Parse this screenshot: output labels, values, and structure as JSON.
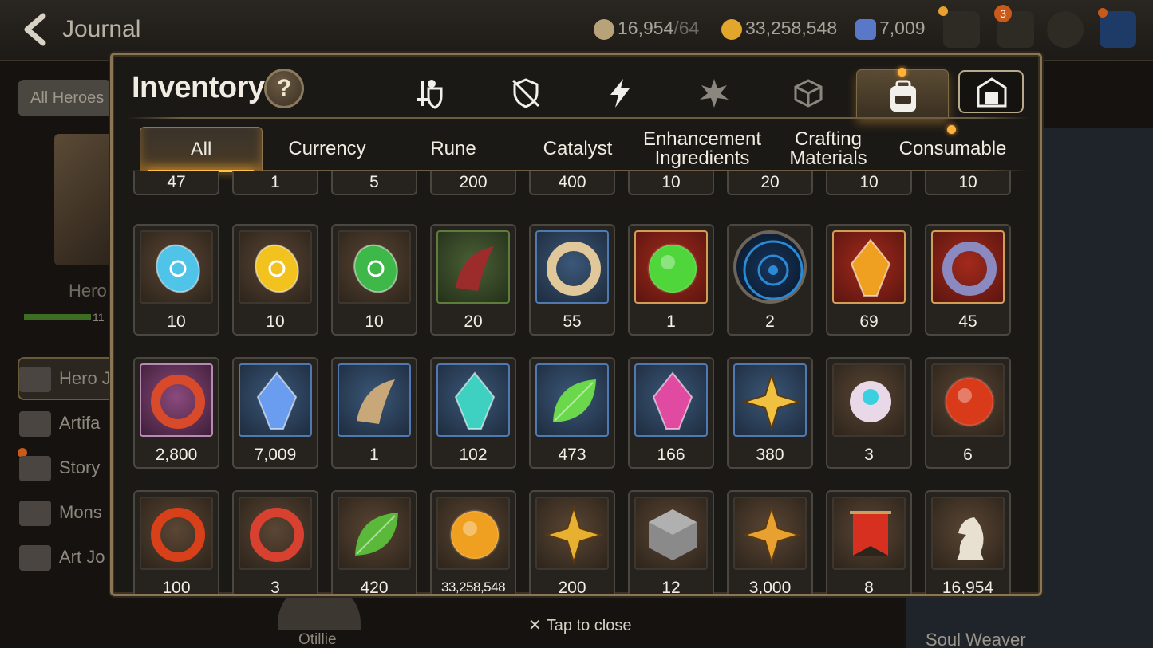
{
  "background": {
    "title": "Journal",
    "resources": [
      {
        "icon": "stamina-icon",
        "value": "16,954",
        "cap": "/64",
        "color": "#b8a27a"
      },
      {
        "icon": "gold-coin-icon",
        "value": "33,258,548",
        "color": "#e2a72a"
      },
      {
        "icon": "skystone-icon",
        "value": "7,009",
        "color": "#5a78c8"
      }
    ],
    "mail_badge": "3",
    "left_tab": "All Heroes",
    "hero_label": "Hero",
    "bar_number": "11",
    "menu": [
      "Hero J",
      "Artifa",
      "Story",
      "Mons",
      "Art Jo"
    ],
    "bottom_hero": "Otillie",
    "right_label": "Soul Weaver",
    "tap_to_close": "Tap to close"
  },
  "inventory": {
    "title": "Inventory",
    "help_label": "?",
    "category_tabs": [
      {
        "icon": "hero-equipment-icon",
        "active": false
      },
      {
        "icon": "no-artifact-icon",
        "active": false
      },
      {
        "icon": "lightning-icon",
        "active": false
      },
      {
        "icon": "burst-icon",
        "active": false
      },
      {
        "icon": "cube-icon",
        "active": false
      },
      {
        "icon": "backpack-icon",
        "active": true
      },
      {
        "icon": "storage-icon",
        "active": false
      }
    ],
    "sub_tabs": [
      {
        "label": "All",
        "active": true
      },
      {
        "label": "Currency",
        "active": false
      },
      {
        "label": "Rune",
        "active": false
      },
      {
        "label": "Catalyst",
        "active": false
      },
      {
        "label": "Enhancement Ingredients",
        "active": false
      },
      {
        "label": "Crafting Materials",
        "active": false
      },
      {
        "label": "Consumable",
        "active": false
      }
    ],
    "rows": [
      {
        "partial": true,
        "items": [
          {
            "icon": "item-icon",
            "qty": "47"
          },
          {
            "icon": "item-icon",
            "qty": "1"
          },
          {
            "icon": "item-icon",
            "qty": "5"
          },
          {
            "icon": "item-icon",
            "qty": "200"
          },
          {
            "icon": "item-icon",
            "qty": "400"
          },
          {
            "icon": "item-icon",
            "qty": "10"
          },
          {
            "icon": "item-icon",
            "qty": "20"
          },
          {
            "icon": "item-icon",
            "qty": "10"
          },
          {
            "icon": "item-icon",
            "qty": "10"
          }
        ]
      },
      {
        "partial": false,
        "items": [
          {
            "icon": "blue-rune-icon",
            "qty": "10",
            "frame": "brown",
            "color": "#4fc3e8"
          },
          {
            "icon": "yellow-rune-icon",
            "qty": "10",
            "frame": "brown",
            "color": "#f2c21e"
          },
          {
            "icon": "green-rune-icon",
            "qty": "10",
            "frame": "brown",
            "color": "#3fb84a"
          },
          {
            "icon": "claw-icon",
            "qty": "20",
            "frame": "green",
            "color": "#9c2b2b"
          },
          {
            "icon": "feather-charm-icon",
            "qty": "55",
            "frame": "blue",
            "color": "#e0c89a"
          },
          {
            "icon": "green-orb-icon",
            "qty": "1",
            "frame": "red",
            "color": "#4ed63a"
          },
          {
            "icon": "rune-disc-icon",
            "qty": "2",
            "frame": "round",
            "color": "#2b8ad6"
          },
          {
            "icon": "fire-crystal-icon",
            "qty": "69",
            "frame": "red",
            "color": "#f0a020"
          },
          {
            "icon": "amulet-icon",
            "qty": "45",
            "frame": "red",
            "color": "#8a8ac0"
          }
        ]
      },
      {
        "partial": false,
        "items": [
          {
            "icon": "red-charm-icon",
            "qty": "2,800",
            "frame": "purple",
            "color": "#d84a2a"
          },
          {
            "icon": "skystone-icon",
            "qty": "7,009",
            "frame": "blue",
            "color": "#6a9cf0"
          },
          {
            "icon": "pendulum-icon",
            "qty": "1",
            "frame": "blue",
            "color": "#c8a878"
          },
          {
            "icon": "teal-crystal-icon",
            "qty": "102",
            "frame": "blue",
            "color": "#3ed0c0"
          },
          {
            "icon": "leaf-icon",
            "qty": "473",
            "frame": "blue",
            "color": "#6ad84a"
          },
          {
            "icon": "pink-crystal-icon",
            "qty": "166",
            "frame": "blue",
            "color": "#e04aa0"
          },
          {
            "icon": "star-compass-icon",
            "qty": "380",
            "frame": "blue",
            "color": "#f0c040"
          },
          {
            "icon": "robot-icon",
            "qty": "3",
            "frame": "brown",
            "color": "#e8d8e8"
          },
          {
            "icon": "fire-orb-icon",
            "qty": "6",
            "frame": "brown",
            "color": "#d83a1a"
          }
        ]
      },
      {
        "partial": false,
        "items": [
          {
            "icon": "ring-icon",
            "qty": "100",
            "frame": "brown",
            "color": "#d8401a"
          },
          {
            "icon": "seal-icon",
            "qty": "3",
            "frame": "brown",
            "color": "#d84030"
          },
          {
            "icon": "heart-leaf-icon",
            "qty": "420",
            "frame": "brown",
            "color": "#5ab83a"
          },
          {
            "icon": "gold-coin-icon",
            "qty": "33,258,548",
            "frame": "brown",
            "color": "#f0a020",
            "small": true
          },
          {
            "icon": "gold-emblem-icon",
            "qty": "200",
            "frame": "brown",
            "color": "#e8b030"
          },
          {
            "icon": "stone-block-icon",
            "qty": "12",
            "frame": "brown",
            "color": "#8a8a8a"
          },
          {
            "icon": "fist-badge-icon",
            "qty": "3,000",
            "frame": "brown",
            "color": "#e8a030"
          },
          {
            "icon": "banner-icon",
            "qty": "8",
            "frame": "brown",
            "color": "#d83020"
          },
          {
            "icon": "knight-piece-icon",
            "qty": "16,954",
            "frame": "brown",
            "color": "#e8e0d0"
          }
        ]
      }
    ]
  }
}
